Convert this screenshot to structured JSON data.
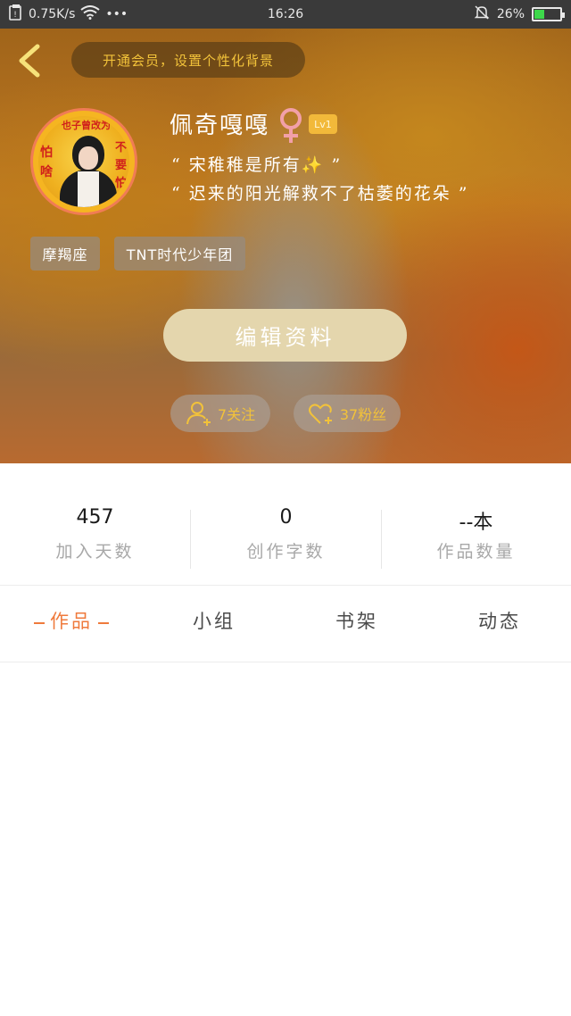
{
  "status_bar": {
    "net_speed": "0.75K/s",
    "more": "•••",
    "time": "16:26",
    "battery": "26%",
    "battery_level": 0.26
  },
  "header": {
    "vip_text": "开通会员，设置个性化背景",
    "username": "佩奇嘎嘎",
    "level": "Lv1",
    "bio_line1": "“ 宋稚稚是所有✨ ”",
    "bio_line2": "“ 迟来的阳光解救不了枯萎的花朵 ”",
    "tags": [
      "摩羯座",
      "TNT时代少年团"
    ],
    "edit_button": "编辑资料",
    "follow": "7关注",
    "fans": "37粉丝",
    "avatar_text": {
      "top": "也子曾改为",
      "left": "怕啥",
      "right": "不要怕"
    }
  },
  "stats": [
    {
      "value": "457",
      "label": "加入天数"
    },
    {
      "value": "0",
      "label": "创作字数"
    },
    {
      "value": "--本",
      "label": "作品数量"
    }
  ],
  "tabs": [
    {
      "label": "作品",
      "active": true
    },
    {
      "label": "小组",
      "active": false
    },
    {
      "label": "书架",
      "active": false
    },
    {
      "label": "动态",
      "active": false
    }
  ],
  "colors": {
    "accent": "#ef7a3c",
    "gold": "#f2c23a",
    "edit_button": "#e4d6ad"
  }
}
